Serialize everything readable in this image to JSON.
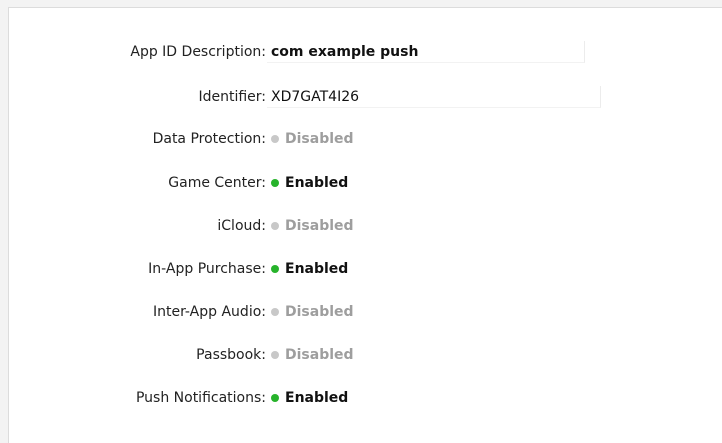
{
  "colors": {
    "enabled_dot": "#27b32b",
    "disabled_dot": "#c8c8c8",
    "enabled_text": "#111111",
    "disabled_text": "#9e9e9e"
  },
  "app_id_description": {
    "label": "App ID Description:",
    "value": "com example push"
  },
  "identifier": {
    "label": "Identifier:",
    "value": "XD7GAT4I26"
  },
  "services": [
    {
      "label": "Data Protection:",
      "status": "Disabled",
      "enabled": false
    },
    {
      "label": "Game Center:",
      "status": "Enabled",
      "enabled": true
    },
    {
      "label": "iCloud:",
      "status": "Disabled",
      "enabled": false
    },
    {
      "label": "In-App Purchase:",
      "status": "Enabled",
      "enabled": true
    },
    {
      "label": "Inter-App Audio:",
      "status": "Disabled",
      "enabled": false
    },
    {
      "label": "Passbook:",
      "status": "Disabled",
      "enabled": false
    },
    {
      "label": "Push Notifications:",
      "status": "Enabled",
      "enabled": true
    }
  ]
}
